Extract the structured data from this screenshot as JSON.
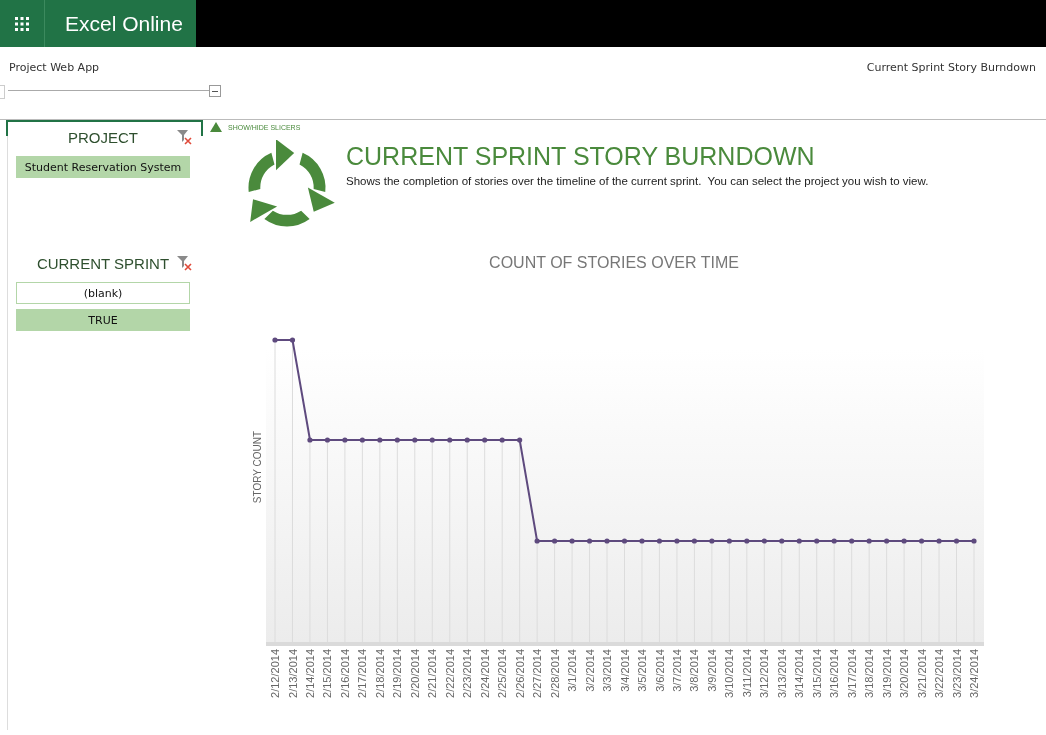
{
  "app_bar": {
    "title": "Excel Online"
  },
  "header": {
    "site": "Project Web App",
    "page_title": "Current Sprint Story Burndown"
  },
  "slicers_toggle": {
    "label": "SHOW/HIDE SLICERS"
  },
  "slicers": [
    {
      "title": "PROJECT",
      "focused": true,
      "items": [
        {
          "label": "Student Reservation System",
          "selected": true
        }
      ]
    },
    {
      "title": "CURRENT SPRINT",
      "focused": false,
      "items": [
        {
          "label": "(blank)",
          "selected": false
        },
        {
          "label": "TRUE",
          "selected": true
        }
      ]
    }
  ],
  "report": {
    "title": "CURRENT SPRINT STORY BURNDOWN",
    "description": "Shows the completion of stories over the timeline of the current sprint.  You can select the project you wish to view."
  },
  "chart": {
    "title": "COUNT OF STORIES OVER TIME",
    "ylabel": "STORY COUNT",
    "x_labels": [
      "2/12/2014",
      "2/13/2014",
      "2/14/2014",
      "2/15/2014",
      "2/16/2014",
      "2/17/2014",
      "2/18/2014",
      "2/19/2014",
      "2/20/2014",
      "2/21/2014",
      "2/22/2014",
      "2/23/2014",
      "2/24/2014",
      "2/25/2014",
      "2/26/2014",
      "2/27/2014",
      "2/28/2014",
      "3/1/2014",
      "3/2/2014",
      "3/3/2014",
      "3/4/2014",
      "3/5/2014",
      "3/6/2014",
      "3/7/2014",
      "3/8/2014",
      "3/9/2014",
      "3/10/2014",
      "3/11/2014",
      "3/12/2014",
      "3/13/2014",
      "3/14/2014",
      "3/15/2014",
      "3/16/2014",
      "3/17/2014",
      "3/18/2014",
      "3/19/2014",
      "3/20/2014",
      "3/21/2014",
      "3/22/2014",
      "3/23/2014",
      "3/24/2014"
    ]
  }
}
